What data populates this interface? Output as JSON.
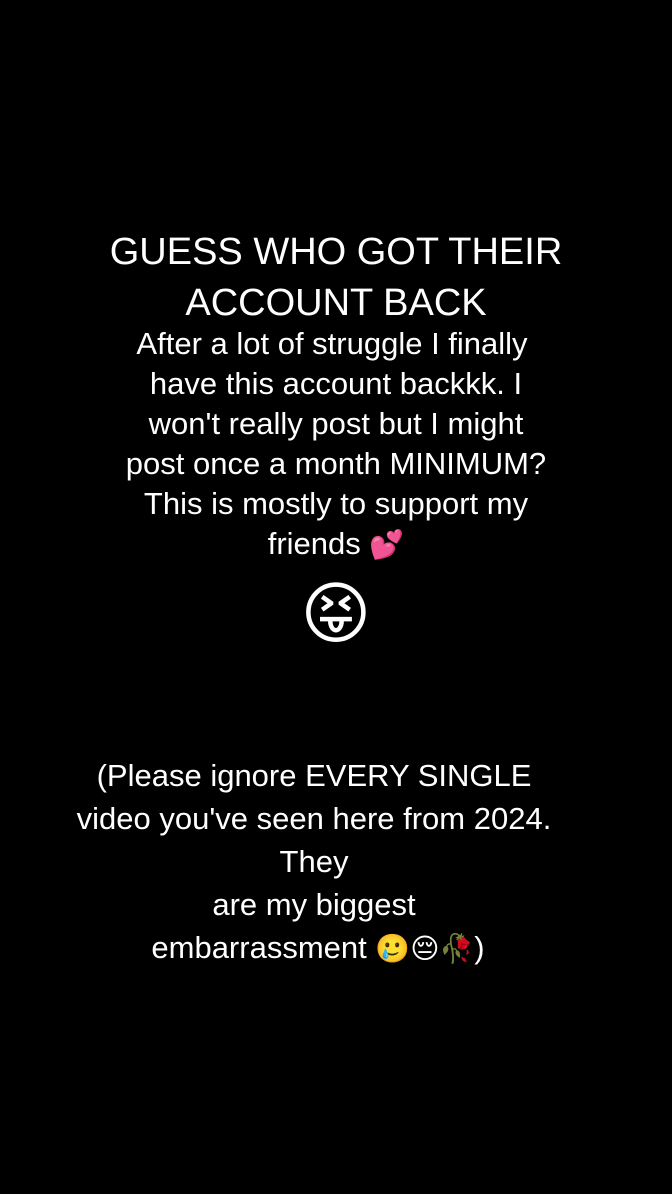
{
  "headline": {
    "line1": "GUESS WHO GOT THEIR",
    "line2": "ACCOUNT BACK"
  },
  "message": {
    "line1": "After a lot of struggle I finally",
    "line2": "have this account backkk. I",
    "line3": "won't really post but I might",
    "line4": "post once a month MINIMUM?",
    "line5": "This is mostly to support my",
    "line6_text": "friends ",
    "line6_emoji": "💕"
  },
  "reaction_emoji": "😝",
  "note": {
    "line1": "(Please ignore EVERY SINGLE",
    "line2": "video you've seen here from 2024.",
    "line3": "They",
    "line4": "are my biggest",
    "line5_text": "embarrassment ",
    "line5_emojis": "🥲😔🥀",
    "line5_close": ")"
  },
  "colors": {
    "background": "#000000",
    "text": "#ffffff"
  }
}
